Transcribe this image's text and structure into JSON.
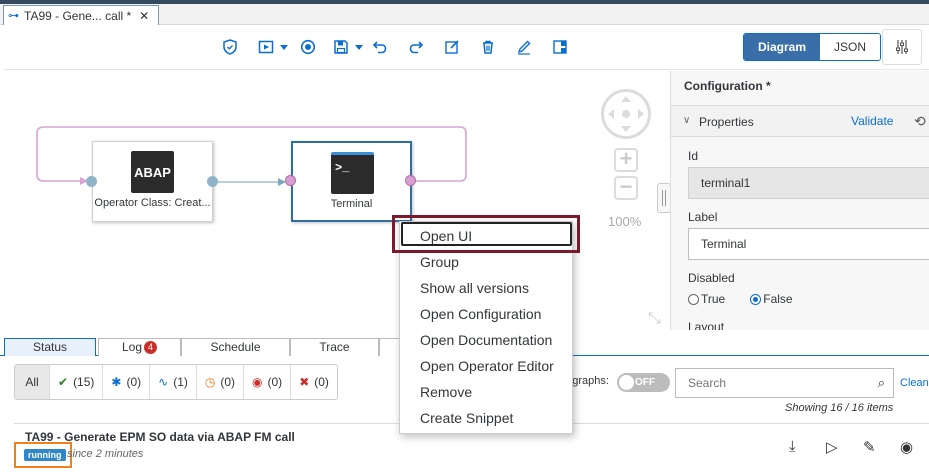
{
  "document_tab": {
    "title": "TA99 - Gene... call *",
    "close": "✕"
  },
  "toolbar": {
    "view_mode": {
      "diagram": "Diagram",
      "json": "JSON",
      "selected": "Diagram"
    }
  },
  "canvas": {
    "nodes": [
      {
        "icon_text": "ABAP",
        "name": "Operator Class: Creat..."
      },
      {
        "icon_text": ">_",
        "name": "Terminal"
      }
    ],
    "zoom": "100%"
  },
  "context_menu": {
    "items": [
      "Open UI",
      "Group",
      "Show all versions",
      "Open Configuration",
      "Open Documentation",
      "Open Operator Editor",
      "Remove",
      "Create Snippet"
    ],
    "focused": "Open UI"
  },
  "config_panel": {
    "title": "Configuration *",
    "section": "Properties",
    "validate": "Validate",
    "id_label": "Id",
    "id_value": "terminal1",
    "label_label": "Label",
    "label_value": "Terminal",
    "disabled_label": "Disabled",
    "radio_true": "True",
    "radio_false": "False",
    "selected": "False",
    "layout_label": "Layout"
  },
  "bottom_tabs": {
    "status": "Status",
    "log": "Log",
    "log_badge": "4",
    "schedule": "Schedule",
    "trace": "Trace",
    "active": "Status"
  },
  "filters": {
    "all": "All",
    "completed": "(15)",
    "debug": "(0)",
    "running": "(1)",
    "pending": "(0)",
    "stopped": "(0)",
    "dead": "(0)"
  },
  "subgraphs": {
    "label": "ubgraphs:",
    "toggle": "OFF"
  },
  "search": {
    "placeholder": "Search",
    "clean": "Clean"
  },
  "showing": "Showing 16 / 16 items",
  "graph_row": {
    "title": "TA99 - Generate EPM SO data via ABAP FM call",
    "status": "running",
    "since": "since 2 minutes"
  },
  "colors": {
    "accent": "#0a6ed1",
    "highlight_box": "#7a1a2c",
    "status_frame": "#f0801a",
    "running_badge": "#2f86c8"
  }
}
